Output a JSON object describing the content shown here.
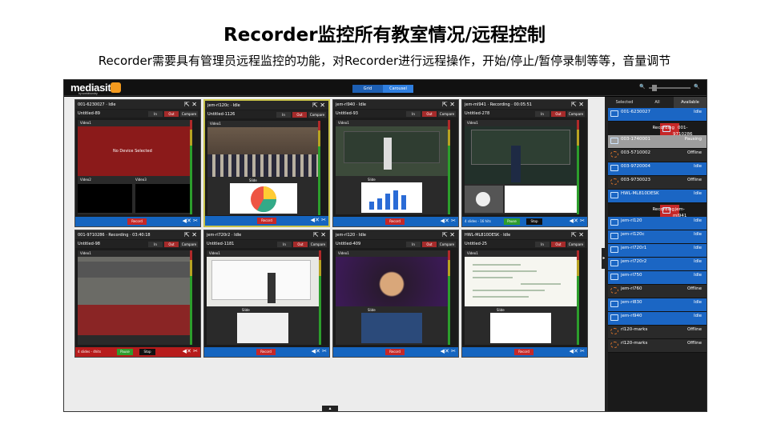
{
  "slide": {
    "title": "Recorder监控所有教室情况/远程控制",
    "subtitle": "Recorder需要具有管理员远程监控的功能，对Recorder进行远程操作，开始/停止/暂停录制等等，音量调节"
  },
  "app": {
    "logo": "mediasite",
    "logo_sub": "by sonicfoundry",
    "view_toggle": [
      "Grid",
      "Carousel"
    ],
    "active_view": "Carousel",
    "tile_buttons": {
      "in": "In",
      "out": "Out",
      "compare": "Compare"
    },
    "record_label": "Record",
    "pause_label": "Pause",
    "stop_label": "Stop",
    "video1_label": "Video1",
    "video2_label": "Video2",
    "video3_label": "Video3",
    "slide_label": "Slide",
    "no_device": "No Device Selected"
  },
  "tiles": [
    {
      "title": "001-6230027 · Idle",
      "sub": "Untitled-89",
      "foot": "blue",
      "status": ""
    },
    {
      "title": "jem-rl120c · Idle",
      "sub": "Untitled-1126",
      "foot": "blue",
      "status": ""
    },
    {
      "title": "jem-rl940 · Idle",
      "sub": "Untitled-93",
      "foot": "blue",
      "status": ""
    },
    {
      "title": "jem-ml941 · Recording · 00:05:51",
      "sub": "Untitled-278",
      "foot": "blue",
      "status": "4 slides - 16 hits"
    },
    {
      "title": "001-9710286 · Recording · 03:40:18",
      "sub": "Untitled-98",
      "foot": "red",
      "status": "4 slides - 4hits"
    },
    {
      "title": "jem-rl720r2 · Idle",
      "sub": "Untitled-1181",
      "foot": "blue",
      "status": ""
    },
    {
      "title": "jem-rl120 · Idle",
      "sub": "Untitled-409",
      "foot": "blue",
      "status": ""
    },
    {
      "title": "HWL-ML810DESK · Idle",
      "sub": "Untitled-25",
      "foot": "blue",
      "status": ""
    }
  ],
  "sidebar": {
    "tabs": [
      "Selected",
      "All",
      "Available"
    ],
    "active_tab": "Available",
    "items": [
      {
        "name": "001-6230027",
        "status": "Idle",
        "kind": "idle"
      },
      {
        "name": "001-9710286",
        "status": "Recording",
        "kind": "rec"
      },
      {
        "name": "003-1740001",
        "status": "Pausing",
        "kind": "pause"
      },
      {
        "name": "003-5710002",
        "status": "Offline",
        "kind": "off"
      },
      {
        "name": "003-9720004",
        "status": "Idle",
        "kind": "idle"
      },
      {
        "name": "003-9730023",
        "status": "Offline",
        "kind": "off"
      },
      {
        "name": "HWL-ML810DESK",
        "status": "Idle",
        "kind": "idle"
      },
      {
        "name": "jem-ml941",
        "status": "Recording",
        "kind": "rec"
      },
      {
        "name": "jem-rl120",
        "status": "Idle",
        "kind": "idle"
      },
      {
        "name": "jem-rl120c",
        "status": "Idle",
        "kind": "idle"
      },
      {
        "name": "jem-rl720r1",
        "status": "Idle",
        "kind": "idle"
      },
      {
        "name": "jem-rl720r2",
        "status": "Idle",
        "kind": "idle"
      },
      {
        "name": "jem-rl750",
        "status": "Idle",
        "kind": "idle"
      },
      {
        "name": "jem-rl760",
        "status": "Offline",
        "kind": "off"
      },
      {
        "name": "jem-rl830",
        "status": "Idle",
        "kind": "idle"
      },
      {
        "name": "jem-rl940",
        "status": "Idle",
        "kind": "idle"
      },
      {
        "name": "rl120-marks",
        "status": "Offline",
        "kind": "off"
      },
      {
        "name": "rl120-marks",
        "status": "Offline",
        "kind": "off"
      }
    ]
  },
  "colors": {
    "idle": "#1b66c4",
    "recording": "#c62828",
    "pausing": "#9e9e9e",
    "offline": "#2a2a2a",
    "accent": "#c8c24a"
  }
}
